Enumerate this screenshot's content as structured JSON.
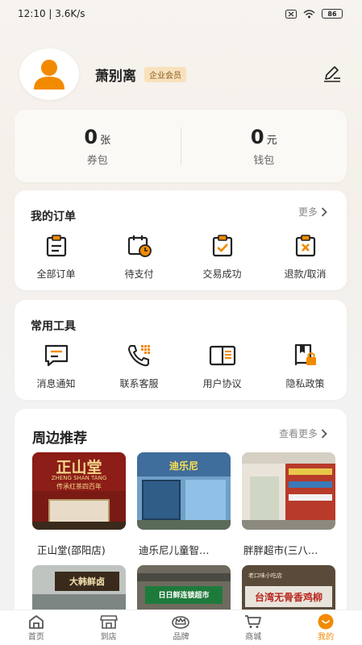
{
  "status_bar": {
    "time_speed": "12:10 | 3.6K/s",
    "battery": "86"
  },
  "profile": {
    "name": "萧别离",
    "badge": "企业会员"
  },
  "wallet": [
    {
      "value": "0",
      "unit": "张",
      "label": "券包"
    },
    {
      "value": "0",
      "unit": "元",
      "label": "钱包"
    }
  ],
  "orders": {
    "title": "我的订单",
    "more": "更多",
    "items": [
      {
        "label": "全部订单",
        "icon": "clipboard-icon"
      },
      {
        "label": "待支付",
        "icon": "calendar-clock-icon"
      },
      {
        "label": "交易成功",
        "icon": "clipboard-check-icon"
      },
      {
        "label": "退款/取消",
        "icon": "clipboard-x-icon"
      }
    ]
  },
  "tools": {
    "title": "常用工具",
    "items": [
      {
        "label": "消息通知",
        "icon": "message-icon"
      },
      {
        "label": "联系客服",
        "icon": "phone-keypad-icon"
      },
      {
        "label": "用户协议",
        "icon": "book-icon"
      },
      {
        "label": "隐私政策",
        "icon": "lock-book-icon"
      }
    ]
  },
  "nearby": {
    "title": "周边推荐",
    "more": "查看更多",
    "shops": [
      {
        "name": "正山堂(邵阳店)",
        "sign": "正山堂",
        "sign_sub": "ZHENG SHAN TANG",
        "sign_sub2": "传承红茶四百年"
      },
      {
        "name": "迪乐尼儿童智…",
        "sign": "迪乐尼"
      },
      {
        "name": "胖胖超市(三八…"
      },
      {
        "name": "",
        "sign": "大韩鲜卤"
      },
      {
        "name": "",
        "sign": "日日鲜连锁超市"
      },
      {
        "name": "",
        "sign": "台湾无骨香鸡柳",
        "sign_sub": "老口味小吃店"
      }
    ]
  },
  "tabbar": [
    {
      "label": "首页",
      "icon": "home-icon",
      "active": false
    },
    {
      "label": "到店",
      "icon": "store-icon",
      "active": false
    },
    {
      "label": "品牌",
      "icon": "crown-icon",
      "active": false
    },
    {
      "label": "商城",
      "icon": "cart-icon",
      "active": false
    },
    {
      "label": "我的",
      "icon": "user-icon",
      "active": true
    }
  ],
  "colors": {
    "accent": "#f28a00",
    "badge_bg": "#f8e2bd",
    "badge_text": "#8a5a1c"
  }
}
